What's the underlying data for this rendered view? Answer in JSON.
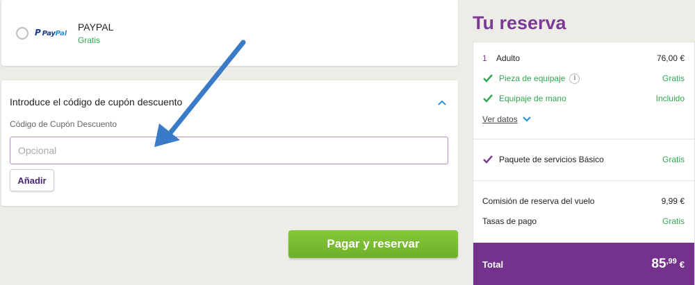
{
  "payment": {
    "paypal_logo_b": "Pay",
    "paypal_logo_l": "Pal",
    "title": "PAYPAL",
    "subtitle": "Gratis"
  },
  "coupon": {
    "title": "Introduce el código de cupón descuento",
    "label": "Código de Cupón Descuento",
    "placeholder": "Opcional",
    "add_label": "Añadir"
  },
  "pay_button": {
    "label": "Pagar y reservar"
  },
  "booking": {
    "title": "Tu reserva",
    "passengers": {
      "count": "1",
      "label": "Adulto",
      "price": "76,00 €"
    },
    "baggage": {
      "label": "Pieza de equipaje",
      "info": "i",
      "value": "Gratis"
    },
    "hand_luggage": {
      "label": "Equipaje de mano",
      "value": "Incluido"
    },
    "details_link": "Ver datos",
    "service_package": {
      "label": "Paquete de servicios Básico",
      "value": "Gratis"
    },
    "booking_fee": {
      "label": "Comisión de reserva del vuelo",
      "value": "9,99 €"
    },
    "payment_fee": {
      "label": "Tasas de pago",
      "value": "Gratis"
    },
    "total": {
      "label": "Total",
      "integer": "85",
      "decimals": ",99",
      "currency": "€"
    }
  },
  "colors": {
    "brand_purple": "#74328c",
    "title_purple": "#7b3a96",
    "success_green": "#2fa84f",
    "pay_green": "#7bbd32",
    "annotation_arrow": "#3a7bc8"
  }
}
